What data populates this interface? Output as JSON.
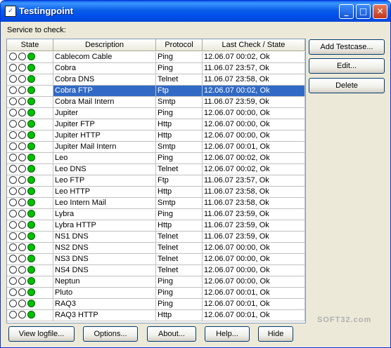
{
  "window": {
    "title": "Testingpoint"
  },
  "service_label": "Service to check:",
  "columns": [
    "State",
    "Description",
    "Protocol",
    "Last Check / State"
  ],
  "rows": [
    {
      "desc": "Cablecom Cable",
      "proto": "Ping",
      "last": "12.06.07 00:02, Ok"
    },
    {
      "desc": "Cobra",
      "proto": "Ping",
      "last": "11.06.07 23:57, Ok"
    },
    {
      "desc": "Cobra DNS",
      "proto": "Telnet",
      "last": "11.06.07 23:58, Ok"
    },
    {
      "desc": "Cobra FTP",
      "proto": "Ftp",
      "last": "12.06.07 00:02, Ok",
      "selected": true
    },
    {
      "desc": "Cobra Mail Intern",
      "proto": "Smtp",
      "last": "11.06.07 23:59, Ok"
    },
    {
      "desc": "Jupiter",
      "proto": "Ping",
      "last": "12.06.07 00:00, Ok"
    },
    {
      "desc": "Jupiter FTP",
      "proto": "Http",
      "last": "12.06.07 00:00, Ok"
    },
    {
      "desc": "Jupiter HTTP",
      "proto": "Http",
      "last": "12.06.07 00:00, Ok"
    },
    {
      "desc": "Jupiter Mail Intern",
      "proto": "Smtp",
      "last": "12.06.07 00:01, Ok"
    },
    {
      "desc": "Leo",
      "proto": "Ping",
      "last": "12.06.07 00:02, Ok"
    },
    {
      "desc": "Leo DNS",
      "proto": "Telnet",
      "last": "12.06.07 00:02, Ok"
    },
    {
      "desc": "Leo FTP",
      "proto": "Ftp",
      "last": "11.06.07 23:57, Ok"
    },
    {
      "desc": "Leo HTTP",
      "proto": "Http",
      "last": "11.06.07 23:58, Ok"
    },
    {
      "desc": "Leo Intern Mail",
      "proto": "Smtp",
      "last": "11.06.07 23:58, Ok"
    },
    {
      "desc": "Lybra",
      "proto": "Ping",
      "last": "11.06.07 23:59, Ok"
    },
    {
      "desc": "Lybra HTTP",
      "proto": "Http",
      "last": "11.06.07 23:59, Ok"
    },
    {
      "desc": "NS1 DNS",
      "proto": "Telnet",
      "last": "11.06.07 23:59, Ok"
    },
    {
      "desc": "NS2 DNS",
      "proto": "Telnet",
      "last": "12.06.07 00:00, Ok"
    },
    {
      "desc": "NS3 DNS",
      "proto": "Telnet",
      "last": "12.06.07 00:00, Ok"
    },
    {
      "desc": "NS4 DNS",
      "proto": "Telnet",
      "last": "12.06.07 00:00, Ok"
    },
    {
      "desc": "Neptun",
      "proto": "Ping",
      "last": "12.06.07 00:00, Ok"
    },
    {
      "desc": "Pluto",
      "proto": "Ping",
      "last": "12.06.07 00:01, Ok"
    },
    {
      "desc": "RAQ3",
      "proto": "Ping",
      "last": "12.06.07 00:01, Ok"
    },
    {
      "desc": "RAQ3 HTTP",
      "proto": "Http",
      "last": "12.06.07 00:01, Ok"
    }
  ],
  "side_buttons": [
    "Add Testcase...",
    "Edit...",
    "Delete"
  ],
  "bottom_buttons": [
    "View logfile...",
    "Options...",
    "About...",
    "Help...",
    "Hide"
  ],
  "watermark": "SOFT32.com",
  "colors": {
    "title_bar": "#0a5fe8",
    "selection": "#316ac5",
    "status_ok": "#00c000",
    "window_bg": "#ece9d8"
  }
}
